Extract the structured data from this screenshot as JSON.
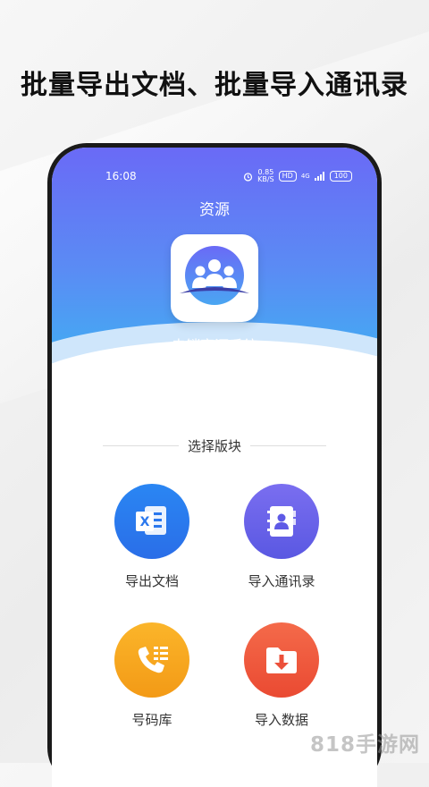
{
  "headline": "批量导出文档、批量导入通讯录",
  "status_bar": {
    "time": "16:08",
    "net_speed": "0.85\nKB/S",
    "hd": "HD",
    "signal": "4G",
    "battery": "100"
  },
  "screen_title": "资源",
  "app": {
    "name": "电销客源系统"
  },
  "section_title": "选择版块",
  "tiles": [
    {
      "label": "导出文档",
      "icon": "excel-document-icon",
      "color": "#2f7ff0"
    },
    {
      "label": "导入通讯录",
      "icon": "contacts-book-icon",
      "color": "#6a63ea"
    },
    {
      "label": "号码库",
      "icon": "phone-list-icon",
      "color": "#f7a21e"
    },
    {
      "label": "导入数据",
      "icon": "import-folder-icon",
      "color": "#f0593e"
    }
  ],
  "watermark": "818手游网"
}
